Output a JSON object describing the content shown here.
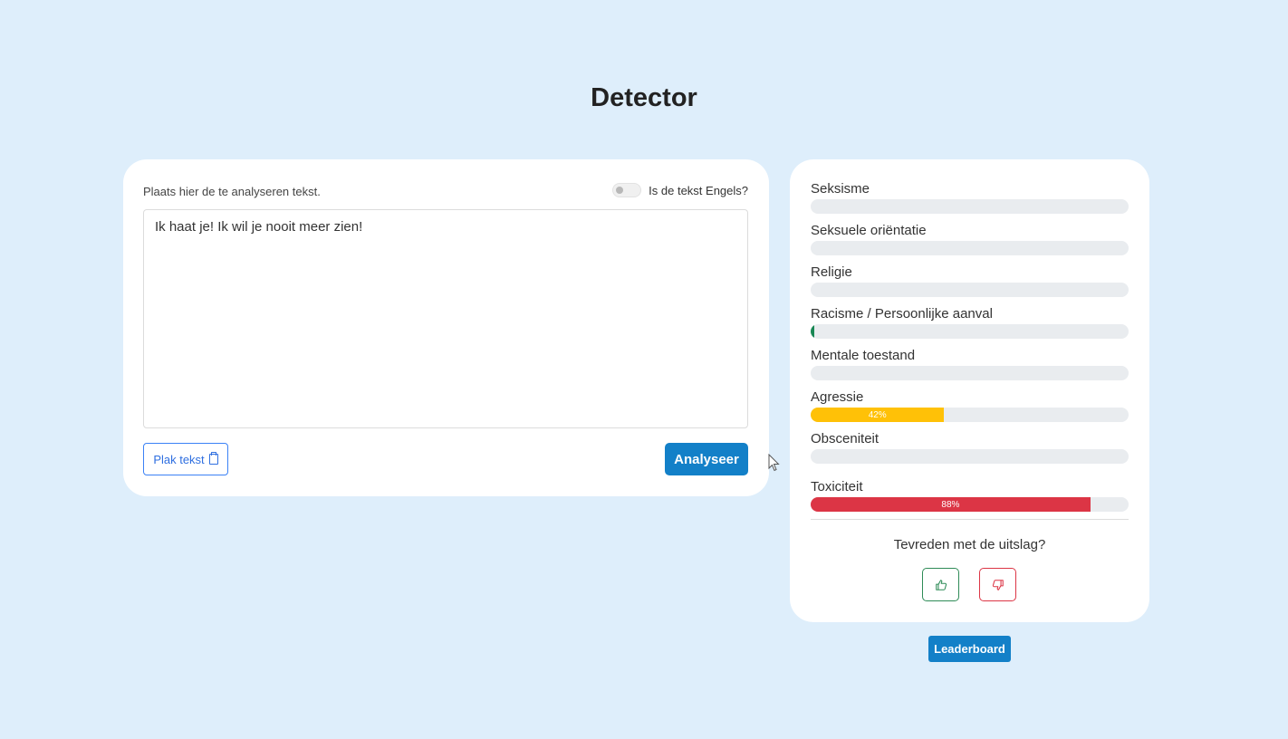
{
  "page": {
    "title": "Detector"
  },
  "input": {
    "label": "Plaats hier de te analyseren tekst.",
    "english_toggle_label": "Is de tekst Engels?",
    "english_toggle_on": false,
    "text": "Ik haat je! Ik wil je nooit meer zien!",
    "paste_label": "Plak tekst",
    "analyze_label": "Analyseer"
  },
  "results": {
    "categories": [
      {
        "label": "Seksisme",
        "value_pct": 0,
        "value_label": "",
        "color": "#e9ecef"
      },
      {
        "label": "Seksuele oriëntatie",
        "value_pct": 0,
        "value_label": "",
        "color": "#e9ecef"
      },
      {
        "label": "Religie",
        "value_pct": 0,
        "value_label": "",
        "color": "#e9ecef"
      },
      {
        "label": "Racisme / Persoonlijke aanval",
        "value_pct": 1,
        "value_label": "",
        "color": "#198754"
      },
      {
        "label": "Mentale toestand",
        "value_pct": 0,
        "value_label": "",
        "color": "#e9ecef"
      },
      {
        "label": "Agressie",
        "value_pct": 42,
        "value_label": "42%",
        "color": "#ffc107"
      },
      {
        "label": "Obsceniteit",
        "value_pct": 0,
        "value_label": "",
        "color": "#e9ecef"
      },
      {
        "label": "Toxiciteit",
        "value_pct": 88,
        "value_label": "88%",
        "color": "#dc3545"
      }
    ]
  },
  "feedback": {
    "question": "Tevreden met de uitslag?",
    "up_icon": "thumbs-up-icon",
    "down_icon": "thumbs-down-icon"
  },
  "leaderboard": {
    "label": "Leaderboard"
  }
}
